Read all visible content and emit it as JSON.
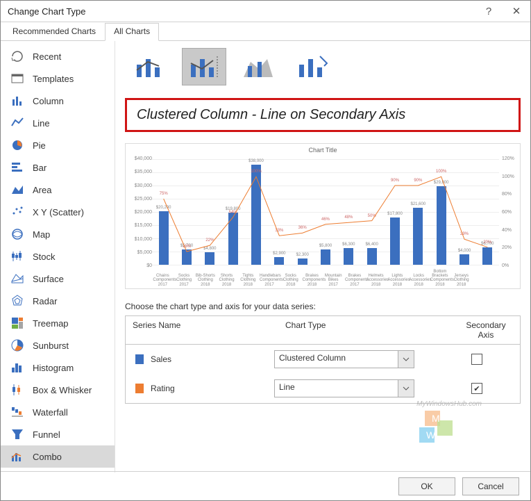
{
  "window": {
    "title": "Change Chart Type",
    "help": "?",
    "close": "✕"
  },
  "tabs": {
    "recommended": "Recommended Charts",
    "all": "All Charts"
  },
  "sidebar": {
    "items": [
      {
        "label": "Recent"
      },
      {
        "label": "Templates"
      },
      {
        "label": "Column"
      },
      {
        "label": "Line"
      },
      {
        "label": "Pie"
      },
      {
        "label": "Bar"
      },
      {
        "label": "Area"
      },
      {
        "label": "X Y (Scatter)"
      },
      {
        "label": "Map"
      },
      {
        "label": "Stock"
      },
      {
        "label": "Surface"
      },
      {
        "label": "Radar"
      },
      {
        "label": "Treemap"
      },
      {
        "label": "Sunburst"
      },
      {
        "label": "Histogram"
      },
      {
        "label": "Box & Whisker"
      },
      {
        "label": "Waterfall"
      },
      {
        "label": "Funnel"
      },
      {
        "label": "Combo"
      }
    ],
    "selected_index": 18
  },
  "subtype_heading": "Clustered Column - Line on Secondary Axis",
  "preview_title": "Chart Title",
  "config": {
    "prompt": "Choose the chart type and axis for your data series:",
    "headers": {
      "series": "Series Name",
      "type": "Chart Type",
      "axis": "Secondary Axis"
    },
    "rows": [
      {
        "name": "Sales",
        "color": "#3b6fbf",
        "type": "Clustered Column",
        "secondary": false
      },
      {
        "name": "Rating",
        "color": "#ed7d31",
        "type": "Line",
        "secondary": true
      }
    ]
  },
  "buttons": {
    "ok": "OK",
    "cancel": "Cancel"
  },
  "watermark": "MyWindowsHub.com",
  "chart_data": {
    "type": "combo",
    "title": "Chart Title",
    "y_left": {
      "min": 0,
      "max": 40000,
      "step": 5000,
      "label": ""
    },
    "y_right": {
      "min": 0,
      "max": 120,
      "step": 20,
      "unit": "%",
      "label": ""
    },
    "categories": [
      "Chains Components 2017",
      "Socks Clothing 2017",
      "Bib-Shorts Clothing 2018",
      "Shorts Clothing 2018",
      "Tights Clothing 2018",
      "Handlebars Components 2017",
      "Socks Clothing 2018",
      "Brakes Components 2018",
      "Mountain Bikes 2017",
      "Brakes Components 2017",
      "Helmets Accessories 2018",
      "Lights Accessories 2018",
      "Locks Accessories 2018",
      "Bottom Brackets Components 2018",
      "Jerseys Clothing 2018"
    ],
    "series": [
      {
        "name": "Sales",
        "type": "bar",
        "axis": "left",
        "color": "#3b6fbf",
        "values": [
          20200,
          5700,
          4800,
          19800,
          38000,
          2900,
          2300,
          5800,
          6300,
          6400,
          17800,
          21600,
          29800,
          4000,
          6700
        ],
        "data_labels": [
          "$20,200",
          "$5,700",
          "$4,800",
          "$19,800",
          "$38,000",
          "$2,900",
          "$2,300",
          "$5,800",
          "$6,300",
          "$6,400",
          "$17,800",
          "$21,600",
          "$29,800",
          "$4,000",
          "$6,700"
        ]
      },
      {
        "name": "Rating",
        "type": "line",
        "axis": "right",
        "color": "#ed7d31",
        "values": [
          75,
          15,
          22,
          54,
          100,
          33,
          36,
          46,
          48,
          50,
          90,
          90,
          100,
          29,
          20
        ],
        "data_labels": [
          "75%",
          "15%",
          "22%",
          "54%",
          "100%",
          "33%",
          "36%",
          "46%",
          "48%",
          "50%",
          "90%",
          "90%",
          "100%",
          "29%",
          "20%"
        ]
      }
    ]
  }
}
